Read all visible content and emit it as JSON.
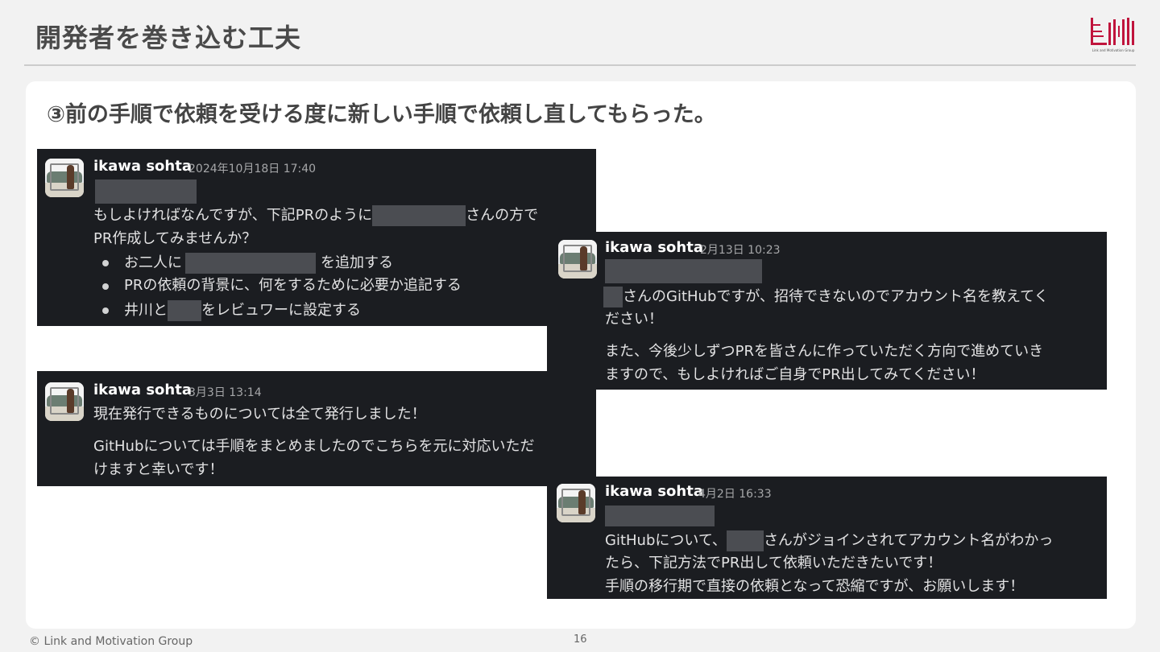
{
  "slide": {
    "title": "開発者を巻き込む工夫",
    "subtitle": "③前の手順で依頼を受ける度に新しい手順で依頼し直してもらった。",
    "logo_caption": "Link and Motivation Group",
    "footer": "© Link and Motivation Group",
    "page_number": "16"
  },
  "messages": [
    {
      "user": "ikawa sohta",
      "time": "2024年10月18日 17:40",
      "lines": [
        "もしよければなんですが、下記PRのように",
        "さんの方で",
        "PR作成してみませんか？"
      ],
      "bullets": [
        {
          "before": "お二人に",
          "after": "を追加する"
        },
        {
          "before": "PRの依頼の背景に、何をするために必要か追記する",
          "after": ""
        },
        {
          "before": "井川と",
          "after": "をレビュワーに設定する"
        }
      ]
    },
    {
      "user": "ikawa sohta",
      "time": "2月13日 10:23",
      "lines": [
        "さんのGitHubですが、招待できないのでアカウント名を教えてく",
        "ださい！",
        "また、今後少しずつPRを皆さんに作っていただく方向で進めていき",
        "ますので、もしよければご自身でPR出してみてください！"
      ]
    },
    {
      "user": "ikawa sohta",
      "time": "3月3日 13:14",
      "lines": [
        "現在発行できるものについては全て発行しました！",
        "GitHubについては手順をまとめましたのでこちらを元に対応いただ",
        "けますと幸いです！"
      ]
    },
    {
      "user": "ikawa sohta",
      "time": "4月2日 16:33",
      "lines": [
        "GitHubについて、",
        "さんがジョインされてアカウント名がわかっ",
        "たら、下記方法でPR出して依頼いただきたいです！",
        "手順の移行期で直接の依頼となって恐縮ですが、お願いします！"
      ]
    }
  ],
  "colors": {
    "slack_bg": "#1b1d21",
    "slide_bg": "#f2f2f2",
    "logo_red": "#c0143c"
  }
}
